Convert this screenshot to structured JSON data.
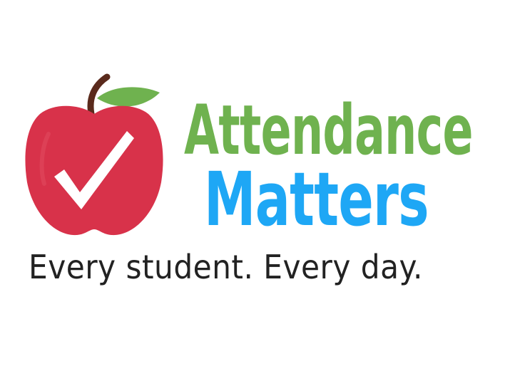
{
  "logo": {
    "title_line_1": "Attendance",
    "title_line_2": "Matters",
    "tagline": "Every student. Every day."
  },
  "colors": {
    "background": "#ffffff",
    "title_line_1": "#6fb24f",
    "title_line_2": "#1ea7f5",
    "tagline": "#222222",
    "apple": "#d8324a",
    "apple_stem": "#5a2a1c",
    "apple_leaf": "#6fb24f",
    "checkmark": "#ffffff"
  },
  "icons": {
    "apple": "apple-icon",
    "checkmark": "checkmark-icon",
    "leaf": "leaf-icon",
    "stem": "stem-icon"
  }
}
